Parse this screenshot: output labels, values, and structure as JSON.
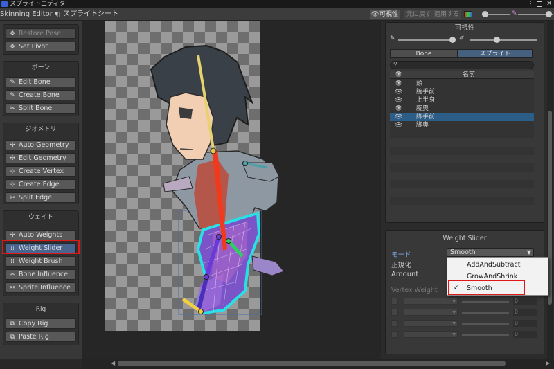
{
  "window": {
    "title": "スプライトエディター"
  },
  "toolbar": {
    "mode_dropdown": "Skinning Editor ▾",
    "sprite_sheet": "スプライトシート",
    "visibility": "可視性",
    "revert": "元に戻す",
    "apply": "適用する"
  },
  "left_panel": {
    "pose": {
      "restore_pose": "Restore Pose",
      "set_pivot": "Set Pivot"
    },
    "bone_group": {
      "title": "ボーン",
      "edit_bone": "Edit Bone",
      "create_bone": "Create Bone",
      "split_bone": "Split Bone"
    },
    "geometry_group": {
      "title": "ジオメトリ",
      "auto_geometry": "Auto Geometry",
      "edit_geometry": "Edit Geometry",
      "create_vertex": "Create Vertex",
      "create_edge": "Create Edge",
      "split_edge": "Split Edge"
    },
    "weight_group": {
      "title": "ウェイト",
      "auto_weights": "Auto Weights",
      "weight_slider": "Weight Slider",
      "weight_brush": "Weight Brush",
      "bone_influence": "Bone Influence",
      "sprite_influence": "Sprite Influence"
    },
    "rig_group": {
      "title": "Rig",
      "copy_rig": "Copy Rig",
      "paste_rig": "Paste Rig"
    }
  },
  "visibility_panel": {
    "title": "可視性",
    "tab_bone": "Bone",
    "tab_sprite": "スプライト",
    "search_placeholder": "",
    "column_name": "名前",
    "rows": [
      {
        "name": "頭",
        "selected": false
      },
      {
        "name": "腕手前",
        "selected": false
      },
      {
        "name": "上半身",
        "selected": false
      },
      {
        "name": "腕奥",
        "selected": false
      },
      {
        "name": "脚手前",
        "selected": true
      },
      {
        "name": "脚奥",
        "selected": false
      }
    ]
  },
  "weight_slider_panel": {
    "title": "Weight Slider",
    "mode_label": "モード",
    "mode_value": "Smooth",
    "normalize_label": "正規化",
    "amount_label": "Amount",
    "vertex_weight_label": "Vertex Weight",
    "vertex_weight_values": [
      "0",
      "0",
      "0",
      "0"
    ],
    "dropdown_options": [
      {
        "label": "AddAndSubtract",
        "checked": false
      },
      {
        "label": "GrowAndShrink",
        "checked": false
      },
      {
        "label": "Smooth",
        "checked": true
      }
    ]
  },
  "colors": {
    "highlight": "#e01818",
    "selection": "#48648f",
    "row_selected": "#2c5d87"
  }
}
